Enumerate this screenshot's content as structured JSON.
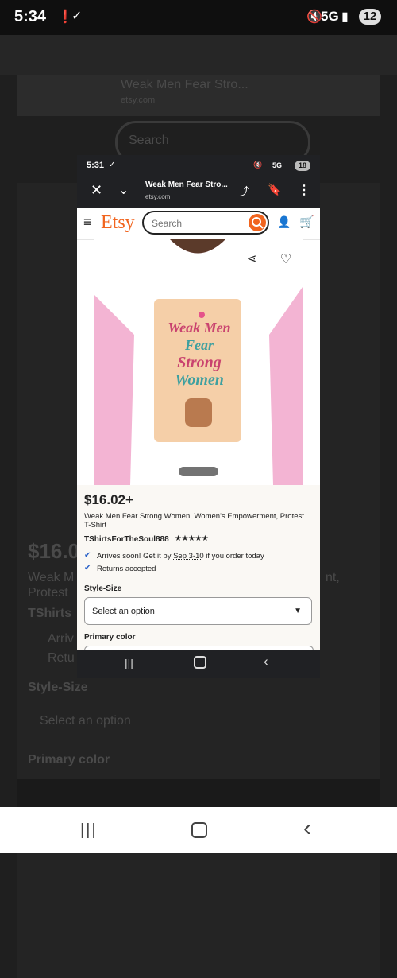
{
  "status": {
    "time": "5:34",
    "network": "5G",
    "battery": "12"
  },
  "background": {
    "tab_title": "Weak Men Fear Stro...",
    "tab_domain": "etsy.com",
    "search_placeholder": "Search",
    "price": "$16.0",
    "title_partial": "Weak M",
    "title_partial2": "Protest",
    "shop_partial": "TShirts",
    "arrives_partial": "Arriv",
    "returns_partial": "Retu",
    "style_size_label": "Style-Size",
    "select_option": "Select an option",
    "primary_color_label": "Primary color",
    "right_partial": "nt,"
  },
  "phone": {
    "status_time": "5:31",
    "network": "5G",
    "battery": "18",
    "tab_title": "Weak Men Fear Stro...",
    "tab_domain": "etsy.com",
    "brand": "Etsy",
    "search_placeholder": "Search",
    "product": {
      "shirt_text": [
        "Weak Men",
        "Fear",
        "Strong",
        "Women"
      ],
      "price": "$16.02+",
      "title": "Weak Men Fear Strong Women, Women's Empowerment, Protest T-Shirt",
      "shop": "TShirtsForTheSoul888",
      "rating_stars": "★★★★★",
      "arrives_prefix": "Arrives soon! Get it by ",
      "arrives_date": "Sep 3-10",
      "arrives_suffix": " if you order today",
      "returns": "Returns accepted",
      "style_size_label": "Style-Size",
      "select_option": "Select an option",
      "primary_color_label": "Primary color"
    }
  },
  "colors": {
    "etsy_orange": "#f1641e",
    "check_blue": "#2a62c9",
    "photo_pink": "#f3b4d3"
  }
}
